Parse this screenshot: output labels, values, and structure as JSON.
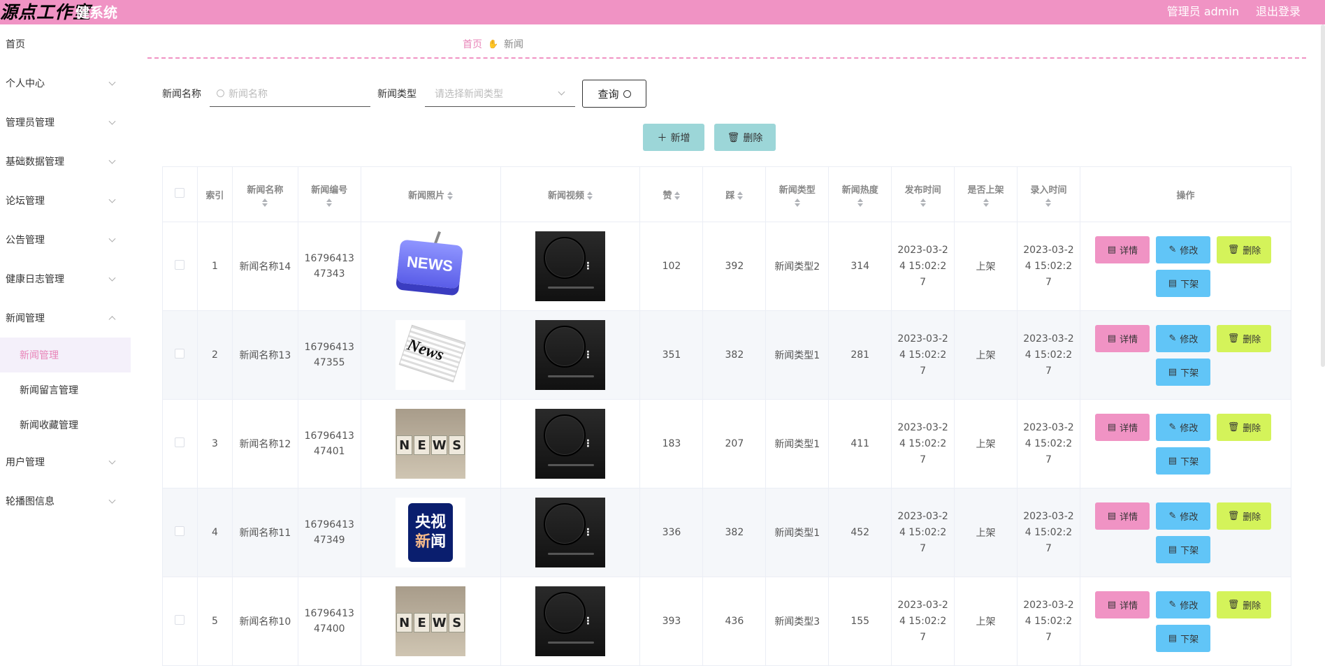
{
  "header": {
    "logo_main": "源点工作室",
    "logo_sub": "健系统",
    "user": "管理员 admin",
    "logout": "退出登录"
  },
  "sidebar": {
    "items": [
      {
        "label": "首页"
      },
      {
        "label": "个人中心"
      },
      {
        "label": "管理员管理"
      },
      {
        "label": "基础数据管理"
      },
      {
        "label": "论坛管理"
      },
      {
        "label": "公告管理"
      },
      {
        "label": "健康日志管理"
      },
      {
        "label": "新闻管理"
      },
      {
        "label": "用户管理"
      },
      {
        "label": "轮播图信息"
      }
    ],
    "sub_items": [
      {
        "label": "新闻管理"
      },
      {
        "label": "新闻留言管理"
      },
      {
        "label": "新闻收藏管理"
      }
    ]
  },
  "breadcrumb": {
    "home": "首页",
    "current": "新闻"
  },
  "search": {
    "name_label": "新闻名称",
    "name_placeholder": "新闻名称",
    "type_label": "新闻类型",
    "type_placeholder": "请选择新闻类型",
    "query_button": "查询"
  },
  "actions": {
    "add": "新增",
    "delete": "删除"
  },
  "table": {
    "headers": {
      "index": "索引",
      "name": "新闻名称",
      "code": "新闻编号",
      "photo": "新闻照片",
      "video": "新闻视频",
      "like": "赞",
      "dislike": "踩",
      "type": "新闻类型",
      "heat": "新闻热度",
      "publish": "发布时间",
      "shelf": "是否上架",
      "entry": "录入时间",
      "ops": "操作"
    },
    "op_labels": {
      "detail": "详情",
      "edit": "修改",
      "delete": "删除",
      "down": "下架"
    },
    "rows": [
      {
        "index": "1",
        "name": "新闻名称14",
        "code": "1679641347343",
        "like": "102",
        "dislike": "392",
        "type": "新闻类型2",
        "heat": "314",
        "publish": "2023-03-24 15:02:27",
        "shelf": "上架",
        "entry": "2023-03-24 15:02:27"
      },
      {
        "index": "2",
        "name": "新闻名称13",
        "code": "1679641347355",
        "like": "351",
        "dislike": "382",
        "type": "新闻类型1",
        "heat": "281",
        "publish": "2023-03-24 15:02:27",
        "shelf": "上架",
        "entry": "2023-03-24 15:02:27"
      },
      {
        "index": "3",
        "name": "新闻名称12",
        "code": "1679641347401",
        "like": "183",
        "dislike": "207",
        "type": "新闻类型1",
        "heat": "411",
        "publish": "2023-03-24 15:02:27",
        "shelf": "上架",
        "entry": "2023-03-24 15:02:27"
      },
      {
        "index": "4",
        "name": "新闻名称11",
        "code": "1679641347349",
        "like": "336",
        "dislike": "382",
        "type": "新闻类型1",
        "heat": "452",
        "publish": "2023-03-24 15:02:27",
        "shelf": "上架",
        "entry": "2023-03-24 15:02:27"
      },
      {
        "index": "5",
        "name": "新闻名称10",
        "code": "1679641347400",
        "like": "393",
        "dislike": "436",
        "type": "新闻类型3",
        "heat": "155",
        "publish": "2023-03-24 15:02:27",
        "shelf": "上架",
        "entry": "2023-03-24 15:02:27"
      }
    ]
  },
  "images": {
    "news_blue_text": "NEWS",
    "news_paper_text": "News",
    "news_cubes_text": "NEWS",
    "cctv_line1": "央视",
    "cctv_line2a": "新",
    "cctv_line2b": "闻"
  },
  "colors": {
    "header_bg": "#f093c4",
    "accent": "#e884b8",
    "detail_btn": "#f093c4",
    "edit_btn": "#61c5f7",
    "delete_btn": "#d4f35a",
    "action_btn": "#9cd6d8"
  }
}
